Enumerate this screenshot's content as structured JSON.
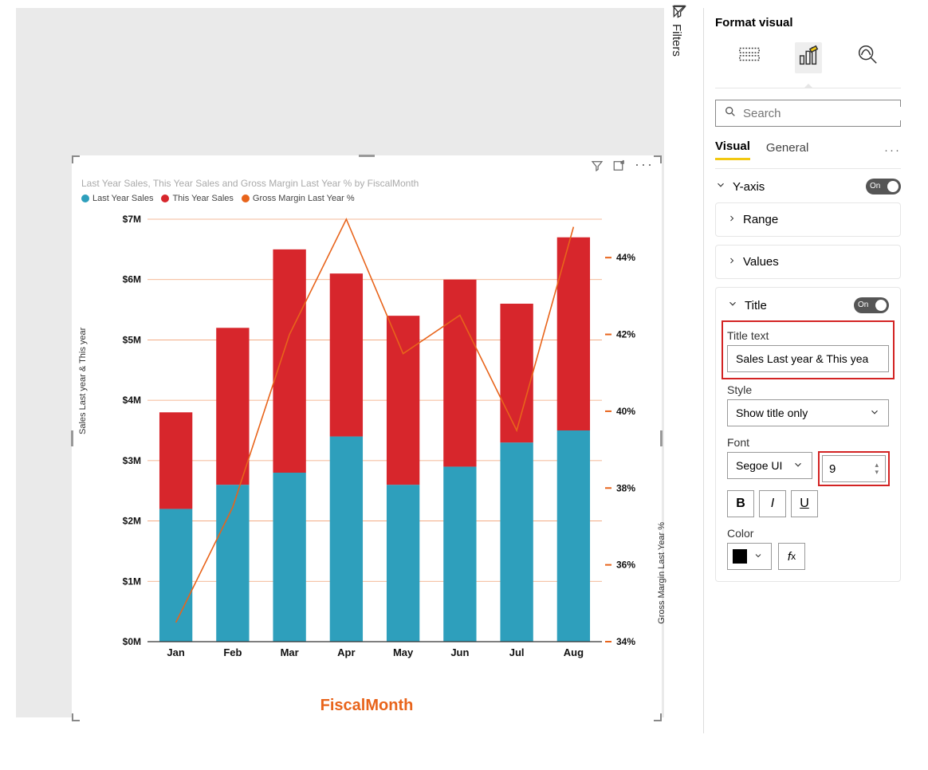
{
  "chart": {
    "title": "Last Year Sales, This Year Sales and Gross Margin Last Year % by FiscalMonth",
    "legend": {
      "s1": "Last Year Sales",
      "s2": "This Year Sales",
      "s3": "Gross Margin Last Year %"
    },
    "yaxis_left_label": "Sales Last year & This year",
    "yaxis_right_label": "Gross Margin Last Year %",
    "xaxis_label": "FiscalMonth"
  },
  "yticks_left": [
    "$0M",
    "$1M",
    "$2M",
    "$3M",
    "$4M",
    "$5M",
    "$6M",
    "$7M"
  ],
  "yticks_right": [
    "34%",
    "36%",
    "38%",
    "40%",
    "42%",
    "44%"
  ],
  "xticks": [
    "Jan",
    "Feb",
    "Mar",
    "Apr",
    "May",
    "Jun",
    "Jul",
    "Aug"
  ],
  "filters_label": "Filters",
  "panel": {
    "title": "Format visual",
    "search_placeholder": "Search",
    "tab_visual": "Visual",
    "tab_general": "General",
    "yaxis_header": "Y-axis",
    "range_label": "Range",
    "values_label": "Values",
    "title_header": "Title",
    "title_text_label": "Title text",
    "title_text_value": "Sales Last year & This yea",
    "style_label": "Style",
    "style_value": "Show title only",
    "font_label": "Font",
    "font_family": "Segoe UI",
    "font_size": "9",
    "color_label": "Color",
    "on_label": "On"
  },
  "colors": {
    "s1": "#2e9fbc",
    "s2": "#d7262c",
    "s3": "#e8641b"
  },
  "chart_data": {
    "type": "bar",
    "title": "Last Year Sales, This Year Sales and Gross Margin Last Year % by FiscalMonth",
    "xlabel": "FiscalMonth",
    "ylabel_left": "Sales Last year & This year",
    "ylabel_right": "Gross Margin Last Year %",
    "categories": [
      "Jan",
      "Feb",
      "Mar",
      "Apr",
      "May",
      "Jun",
      "Jul",
      "Aug"
    ],
    "left_ylim": [
      0,
      7
    ],
    "left_unit": "$M",
    "right_ylim": [
      34,
      45
    ],
    "right_unit": "%",
    "series": [
      {
        "name": "Last Year Sales",
        "type": "bar-stack-bottom",
        "axis": "left",
        "values": [
          2.2,
          2.6,
          2.8,
          3.4,
          2.6,
          2.9,
          3.3,
          3.5
        ],
        "color": "#2e9fbc"
      },
      {
        "name": "This Year Sales",
        "type": "bar-stack-top",
        "axis": "left",
        "values": [
          1.6,
          2.6,
          3.7,
          2.7,
          2.8,
          3.1,
          2.3,
          3.2
        ],
        "color": "#d7262c"
      },
      {
        "name": "Gross Margin Last Year %",
        "type": "line",
        "axis": "right",
        "values": [
          34.5,
          37.5,
          42.0,
          45.0,
          41.5,
          42.5,
          39.5,
          44.8
        ],
        "color": "#e8641b"
      }
    ]
  }
}
